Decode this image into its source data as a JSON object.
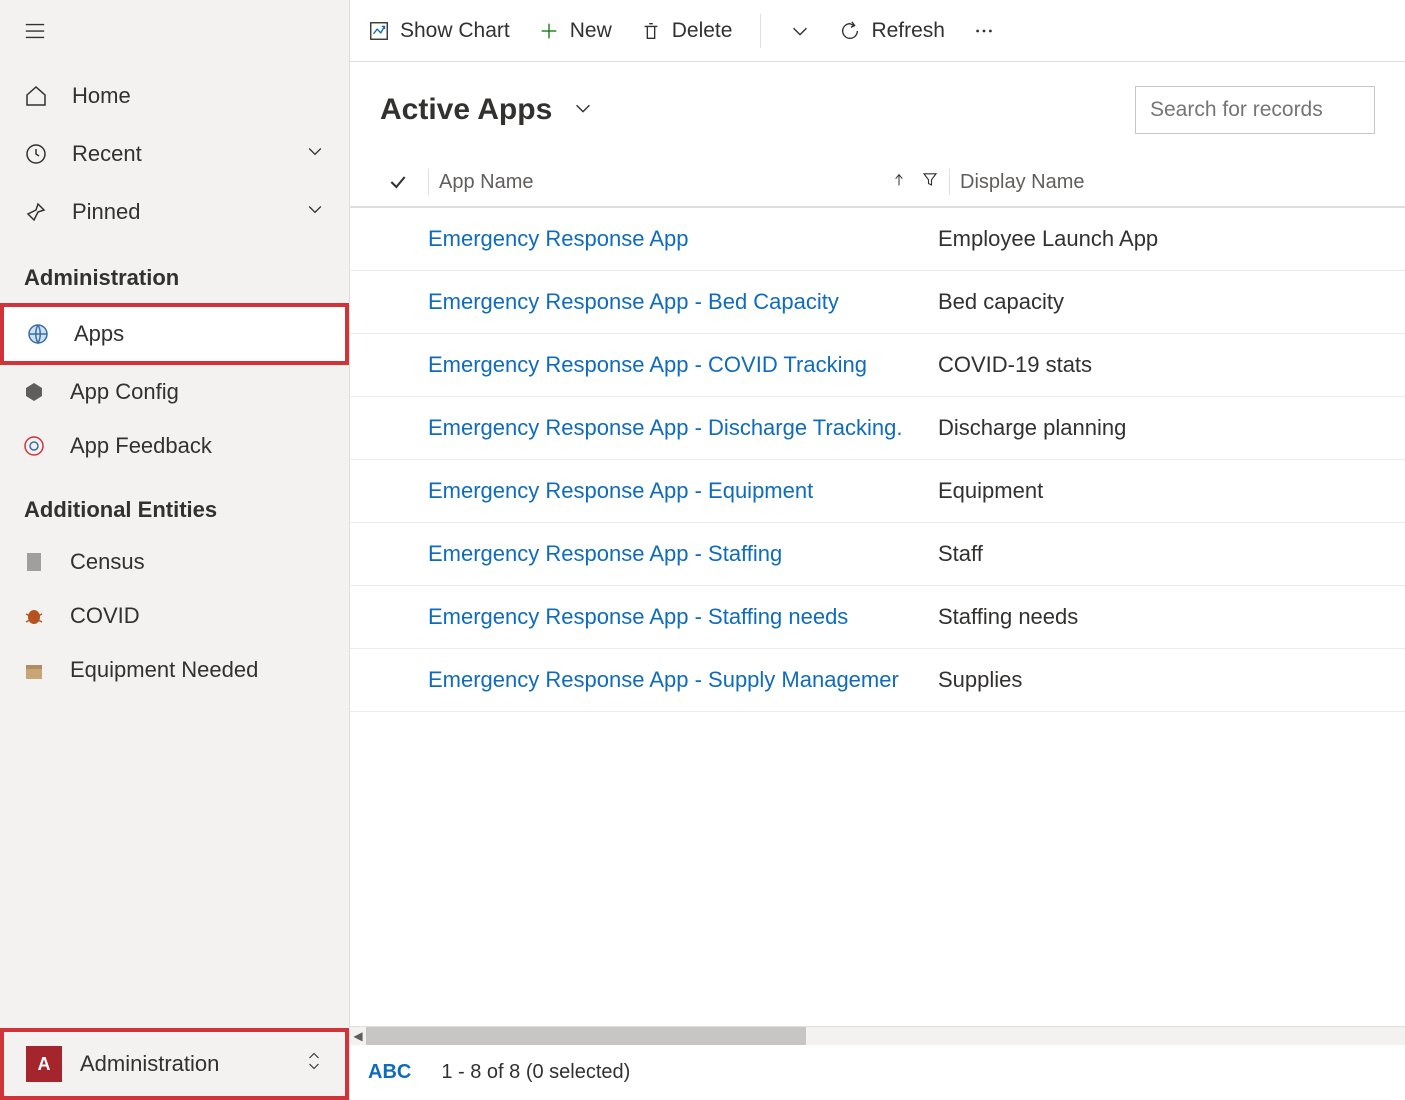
{
  "sidebar": {
    "home": "Home",
    "recent": "Recent",
    "pinned": "Pinned",
    "section_admin": "Administration",
    "apps": "Apps",
    "app_config": "App Config",
    "app_feedback": "App Feedback",
    "section_additional": "Additional Entities",
    "census": "Census",
    "covid": "COVID",
    "equip_needed": "Equipment Needed",
    "area_badge": "A",
    "area_label": "Administration"
  },
  "cmd": {
    "show_chart": "Show Chart",
    "new": "New",
    "delete": "Delete",
    "refresh": "Refresh"
  },
  "view": {
    "title": "Active Apps",
    "search_placeholder": "Search for records"
  },
  "cols": {
    "app_name": "App Name",
    "display_name": "Display Name"
  },
  "rows": [
    {
      "app": "Emergency Response App",
      "disp": "Employee Launch App"
    },
    {
      "app": "Emergency Response App - Bed Capacity",
      "disp": "Bed capacity"
    },
    {
      "app": "Emergency Response App - COVID Tracking",
      "disp": "COVID-19 stats"
    },
    {
      "app": "Emergency Response App - Discharge Tracking.",
      "disp": "Discharge planning"
    },
    {
      "app": "Emergency Response App - Equipment",
      "disp": "Equipment"
    },
    {
      "app": "Emergency Response App - Staffing",
      "disp": "Staff"
    },
    {
      "app": "Emergency Response App - Staffing needs",
      "disp": "Staffing needs"
    },
    {
      "app": "Emergency Response App - Supply Managemer",
      "disp": "Supplies"
    }
  ],
  "footer": {
    "abc": "ABC",
    "count": "1 - 8 of 8 (0 selected)"
  }
}
